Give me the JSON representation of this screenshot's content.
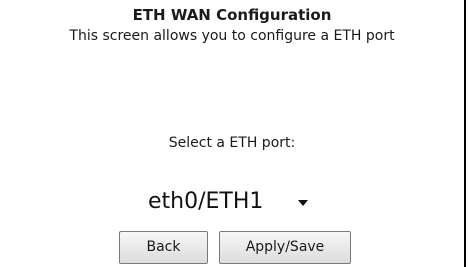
{
  "header": {
    "title": "ETH WAN Configuration",
    "description": "This screen allows you to configure a ETH port"
  },
  "port": {
    "label": "Select a ETH port:",
    "selected": "eth0/ETH1"
  },
  "buttons": {
    "back_label": "Back",
    "apply_label": "Apply/Save"
  }
}
